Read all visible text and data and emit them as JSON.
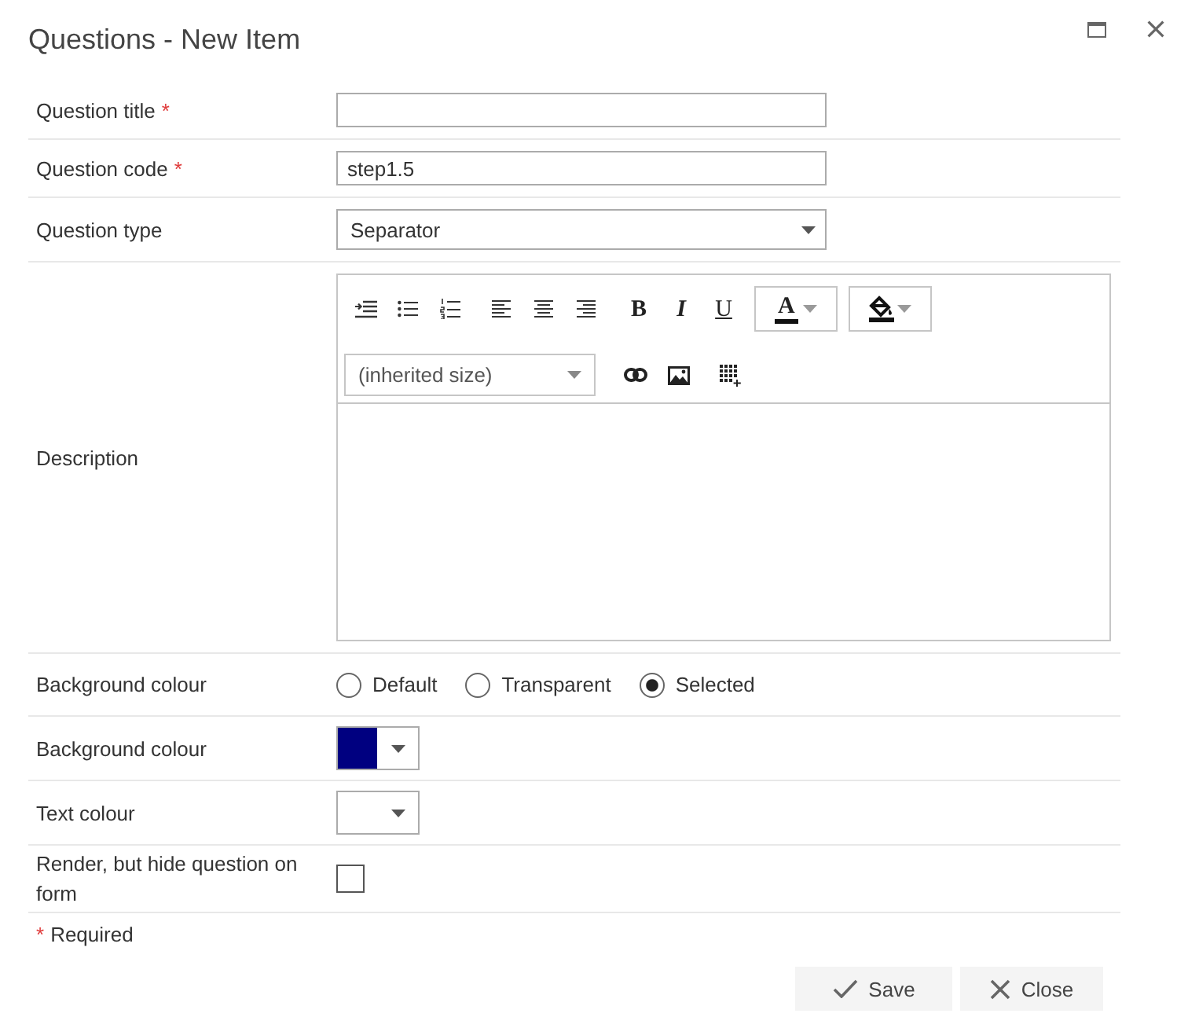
{
  "window": {
    "title": "Questions - New Item"
  },
  "fields": [
    {
      "kind": "text",
      "label": "Question title",
      "required_mark": "*"
    },
    {
      "kind": "text",
      "label": "Question code",
      "required_mark": "*",
      "value": "step1.5"
    },
    {
      "kind": "select",
      "label": "Question type",
      "value": "Separator"
    },
    {
      "kind": "richtext",
      "label": "Description",
      "format_buttons": [
        {
          "kind": "bold",
          "label": "B"
        },
        {
          "kind": "italic",
          "label": "I"
        },
        {
          "kind": "underline",
          "label": "U"
        }
      ],
      "text_color_button": {
        "label": "A"
      },
      "font_size": "(inherited size)"
    },
    {
      "kind": "radio",
      "label": "Background colour",
      "options": [
        {
          "label": "Default",
          "selected": false
        },
        {
          "label": "Transparent",
          "selected": false
        },
        {
          "label": "Selected",
          "selected": true
        }
      ]
    },
    {
      "kind": "color",
      "label": "Background colour",
      "color": "#000080"
    },
    {
      "kind": "color",
      "label": "Text colour"
    },
    {
      "kind": "checkbox",
      "label": "Render, but hide question on form",
      "checked": false
    }
  ],
  "required_note": {
    "mark": "*",
    "text": "Required"
  },
  "buttons": [
    {
      "kind": "save",
      "label": "Save"
    },
    {
      "kind": "close",
      "label": "Close"
    }
  ]
}
